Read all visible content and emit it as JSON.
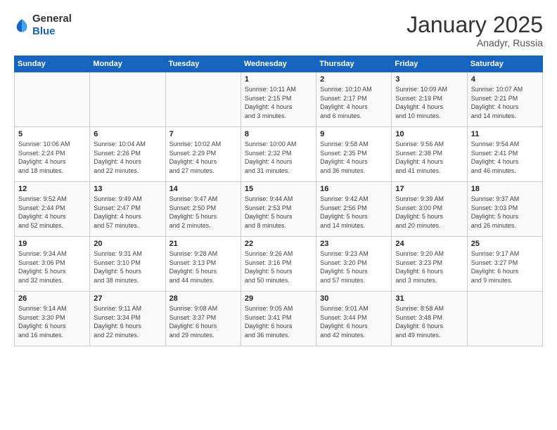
{
  "header": {
    "logo_general": "General",
    "logo_blue": "Blue",
    "month": "January 2025",
    "location": "Anadyr, Russia"
  },
  "days_of_week": [
    "Sunday",
    "Monday",
    "Tuesday",
    "Wednesday",
    "Thursday",
    "Friday",
    "Saturday"
  ],
  "weeks": [
    [
      {
        "day": "",
        "info": ""
      },
      {
        "day": "",
        "info": ""
      },
      {
        "day": "",
        "info": ""
      },
      {
        "day": "1",
        "info": "Sunrise: 10:11 AM\nSunset: 2:15 PM\nDaylight: 4 hours\nand 3 minutes."
      },
      {
        "day": "2",
        "info": "Sunrise: 10:10 AM\nSunset: 2:17 PM\nDaylight: 4 hours\nand 6 minutes."
      },
      {
        "day": "3",
        "info": "Sunrise: 10:09 AM\nSunset: 2:19 PM\nDaylight: 4 hours\nand 10 minutes."
      },
      {
        "day": "4",
        "info": "Sunrise: 10:07 AM\nSunset: 2:21 PM\nDaylight: 4 hours\nand 14 minutes."
      }
    ],
    [
      {
        "day": "5",
        "info": "Sunrise: 10:06 AM\nSunset: 2:24 PM\nDaylight: 4 hours\nand 18 minutes."
      },
      {
        "day": "6",
        "info": "Sunrise: 10:04 AM\nSunset: 2:26 PM\nDaylight: 4 hours\nand 22 minutes."
      },
      {
        "day": "7",
        "info": "Sunrise: 10:02 AM\nSunset: 2:29 PM\nDaylight: 4 hours\nand 27 minutes."
      },
      {
        "day": "8",
        "info": "Sunrise: 10:00 AM\nSunset: 2:32 PM\nDaylight: 4 hours\nand 31 minutes."
      },
      {
        "day": "9",
        "info": "Sunrise: 9:58 AM\nSunset: 2:35 PM\nDaylight: 4 hours\nand 36 minutes."
      },
      {
        "day": "10",
        "info": "Sunrise: 9:56 AM\nSunset: 2:38 PM\nDaylight: 4 hours\nand 41 minutes."
      },
      {
        "day": "11",
        "info": "Sunrise: 9:54 AM\nSunset: 2:41 PM\nDaylight: 4 hours\nand 46 minutes."
      }
    ],
    [
      {
        "day": "12",
        "info": "Sunrise: 9:52 AM\nSunset: 2:44 PM\nDaylight: 4 hours\nand 52 minutes."
      },
      {
        "day": "13",
        "info": "Sunrise: 9:49 AM\nSunset: 2:47 PM\nDaylight: 4 hours\nand 57 minutes."
      },
      {
        "day": "14",
        "info": "Sunrise: 9:47 AM\nSunset: 2:50 PM\nDaylight: 5 hours\nand 2 minutes."
      },
      {
        "day": "15",
        "info": "Sunrise: 9:44 AM\nSunset: 2:53 PM\nDaylight: 5 hours\nand 8 minutes."
      },
      {
        "day": "16",
        "info": "Sunrise: 9:42 AM\nSunset: 2:56 PM\nDaylight: 5 hours\nand 14 minutes."
      },
      {
        "day": "17",
        "info": "Sunrise: 9:39 AM\nSunset: 3:00 PM\nDaylight: 5 hours\nand 20 minutes."
      },
      {
        "day": "18",
        "info": "Sunrise: 9:37 AM\nSunset: 3:03 PM\nDaylight: 5 hours\nand 26 minutes."
      }
    ],
    [
      {
        "day": "19",
        "info": "Sunrise: 9:34 AM\nSunset: 3:06 PM\nDaylight: 5 hours\nand 32 minutes."
      },
      {
        "day": "20",
        "info": "Sunrise: 9:31 AM\nSunset: 3:10 PM\nDaylight: 5 hours\nand 38 minutes."
      },
      {
        "day": "21",
        "info": "Sunrise: 9:28 AM\nSunset: 3:13 PM\nDaylight: 5 hours\nand 44 minutes."
      },
      {
        "day": "22",
        "info": "Sunrise: 9:26 AM\nSunset: 3:16 PM\nDaylight: 5 hours\nand 50 minutes."
      },
      {
        "day": "23",
        "info": "Sunrise: 9:23 AM\nSunset: 3:20 PM\nDaylight: 5 hours\nand 57 minutes."
      },
      {
        "day": "24",
        "info": "Sunrise: 9:20 AM\nSunset: 3:23 PM\nDaylight: 6 hours\nand 3 minutes."
      },
      {
        "day": "25",
        "info": "Sunrise: 9:17 AM\nSunset: 3:27 PM\nDaylight: 6 hours\nand 9 minutes."
      }
    ],
    [
      {
        "day": "26",
        "info": "Sunrise: 9:14 AM\nSunset: 3:30 PM\nDaylight: 6 hours\nand 16 minutes."
      },
      {
        "day": "27",
        "info": "Sunrise: 9:11 AM\nSunset: 3:34 PM\nDaylight: 6 hours\nand 22 minutes."
      },
      {
        "day": "28",
        "info": "Sunrise: 9:08 AM\nSunset: 3:37 PM\nDaylight: 6 hours\nand 29 minutes."
      },
      {
        "day": "29",
        "info": "Sunrise: 9:05 AM\nSunset: 3:41 PM\nDaylight: 6 hours\nand 36 minutes."
      },
      {
        "day": "30",
        "info": "Sunrise: 9:01 AM\nSunset: 3:44 PM\nDaylight: 6 hours\nand 42 minutes."
      },
      {
        "day": "31",
        "info": "Sunrise: 8:58 AM\nSunset: 3:48 PM\nDaylight: 6 hours\nand 49 minutes."
      },
      {
        "day": "",
        "info": ""
      }
    ]
  ]
}
